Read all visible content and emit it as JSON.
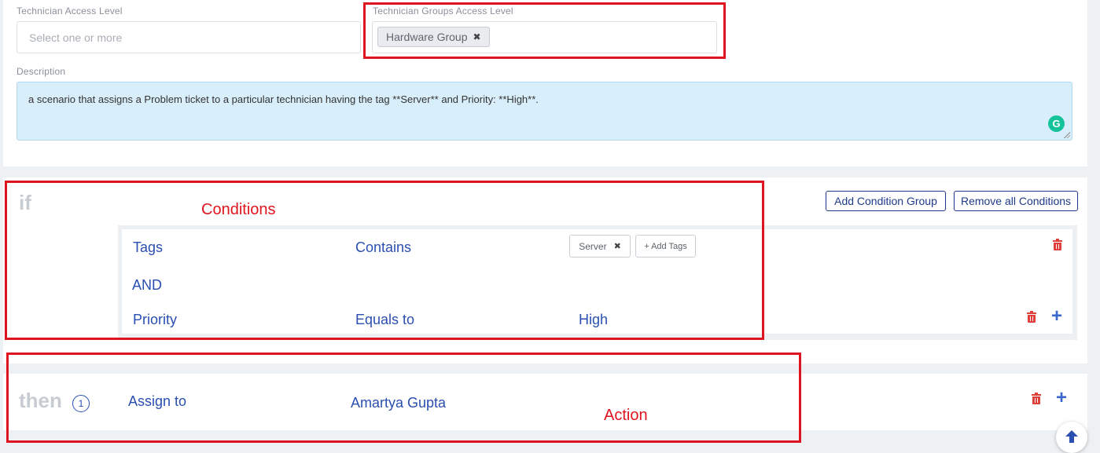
{
  "form": {
    "technician_access_label": "Technician Access Level",
    "technician_access_placeholder": "Select one or more",
    "groups_access_label": "Technician Groups Access Level",
    "groups_selected": "Hardware Group",
    "description_label": "Description",
    "description_value": "a scenario that assigns a Problem ticket to a particular technician having the tag **Server** and Priority: **High**.",
    "grammarly_icon_text": "G"
  },
  "conditions": {
    "keyword": "if",
    "add_group_label": "Add Condition Group",
    "remove_all_label": "Remove all Conditions",
    "rows": [
      {
        "field": "Tags",
        "operator": "Contains",
        "tag": "Server",
        "add_tags_label": "+ Add Tags"
      },
      {
        "field": "Priority",
        "operator": "Equals to",
        "value": "High"
      }
    ],
    "joiner": "AND"
  },
  "actions": {
    "keyword": "then",
    "count": "1",
    "field": "Assign to",
    "value": "Amartya Gupta"
  },
  "annotations": {
    "conditions_label": "Conditions",
    "action_label": "Action"
  },
  "colors": {
    "accent_blue": "#2a4fb0",
    "delete_red": "#e0403a",
    "annotation_red": "#e0141e",
    "description_bg": "#d9eefb"
  },
  "icons": {
    "chip_remove": "close-icon",
    "delete": "trash-icon",
    "add": "plus-icon",
    "scroll": "arrow-up-icon"
  }
}
